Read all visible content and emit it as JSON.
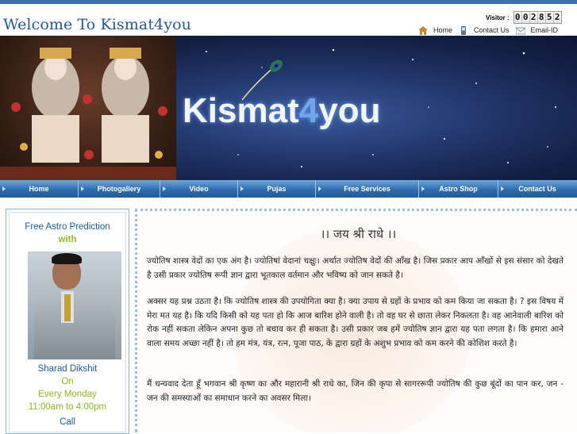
{
  "header": {
    "site_title": "Welcome To Kismat4you",
    "visitor_label": "Visitor :",
    "visitor_count": [
      "0",
      "0",
      "2",
      "8",
      "5",
      "2"
    ],
    "links": [
      {
        "label": "Home",
        "icon": "home-icon"
      },
      {
        "label": "Contact Us",
        "icon": "phone-icon"
      },
      {
        "label": "Email-ID",
        "icon": "mail-icon"
      }
    ]
  },
  "banner": {
    "brand_prefix": "ismat",
    "brand_k": "K",
    "brand_four": "4",
    "brand_suffix": "you"
  },
  "nav": {
    "items": [
      "Home",
      "Photogallery",
      "Video",
      "Pujas",
      "Free Services",
      "Astro Shop",
      "Contact Us"
    ]
  },
  "sidebar": {
    "title": "Free Astro Prediction",
    "with": "with",
    "name": "Sharad Dikshit",
    "day_on": "On",
    "day": "Every Monday",
    "time": "11:00am to 4:00pm",
    "call": "Call"
  },
  "content": {
    "heading": "।। जय श्री राधे ।।",
    "paragraphs": [
      "ज्योतिष शास्त्र वेदों का एक अंग है। ज्योतिषां वेदानां चक्षुः। अर्थात ज्योतिष वेदों की आँख है। जिस प्रकार आप आँखों से इस संसार को देखते है उसी प्रकार ज्योतिष रूपी ज्ञान द्वारा भूतकाल वर्तमान और भविष्य को जान सकते है।",
      "अक्सर यह प्रश्न उठता है। कि ज्योतिष शास्त्र की उपयोगिता क्या है। क्या उपाय से ग्रहों के प्रभाव को कम किया जा सकता है। ? इस विषय में मेरा मत यह है। कि यदि किसी को यह पता हो कि आज बारिश होने वाली है। तो वह घर से छाता लेकर निकलता है। वह आनेवाली बारिश को रोक नहीं सकता लेकिन अपना कुछ तो बचाव कर ही सकता है। उसी प्रकार जब हमें ज्योतिष ज्ञान द्वारा यह पता लगता है। कि हमारा आने वाला समय अच्छा नहीं है। तो हम मंत्र, यंत्र, रत्न, पूजा पाठ, के द्वारा ग्रहों के अशुभ प्रभाव को कम करने की कोशिश करते है।",
      "मैं धन्यवाद देता हूँ भगवान श्री कृष्ण का और महारानी श्री राधे का, जिन की कृपा से सागररूपी ज्योतिष की कुछ बूंदों का पान कर, जन - जन की समस्याओं का समाधान करने  का अवसर मिला।"
    ]
  }
}
